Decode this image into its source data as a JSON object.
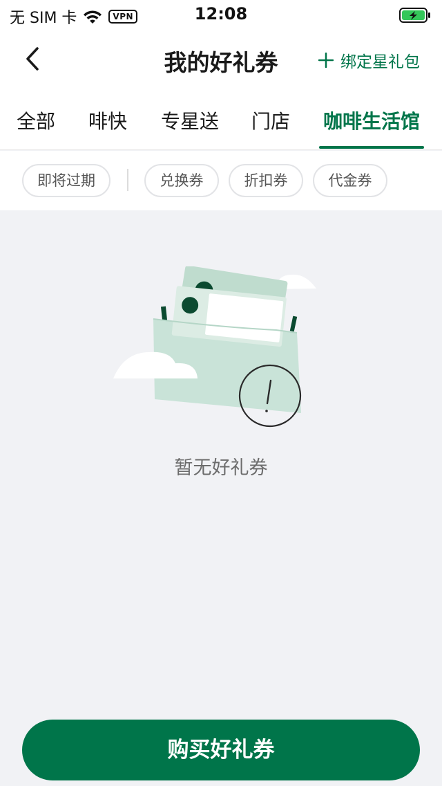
{
  "status_bar": {
    "carrier": "无 SIM 卡",
    "vpn": "VPN",
    "time": "12:08",
    "icons": [
      "wifi-icon",
      "battery-charging-icon"
    ]
  },
  "nav": {
    "back_icon": "chevron-left-icon",
    "title": "我的好礼券",
    "bind_label": "绑定星礼包",
    "bind_icon": "plus-icon"
  },
  "tabs": [
    {
      "label": "全部",
      "active": false
    },
    {
      "label": "啡快",
      "active": false
    },
    {
      "label": "专星送",
      "active": false
    },
    {
      "label": "门店",
      "active": false
    },
    {
      "label": "咖啡生活馆",
      "active": true
    }
  ],
  "filters": [
    {
      "label": "即将过期"
    },
    {
      "label": "兑换券"
    },
    {
      "label": "折扣券"
    },
    {
      "label": "代金券"
    }
  ],
  "empty_state": {
    "illustration": "empty-wallet-illustration",
    "text": "暂无好礼券"
  },
  "bottom_button": {
    "label": "购买好礼券"
  },
  "colors": {
    "accent": "#00754a",
    "background": "#f1f2f5",
    "illustration_mint": "#c9e3d8",
    "illustration_dark": "#0b4a30"
  }
}
